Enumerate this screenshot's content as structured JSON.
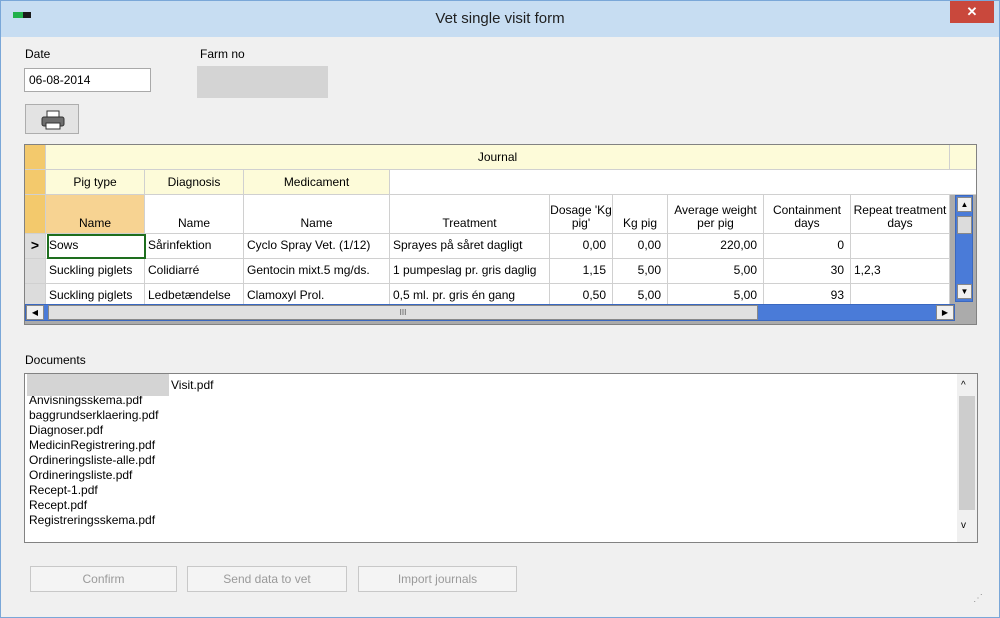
{
  "window": {
    "title": "Vet single visit form",
    "close_glyph": "✕"
  },
  "form": {
    "date_label": "Date",
    "date_value": "06-08-2014",
    "farm_no_label": "Farm no",
    "print_icon": "printer-icon"
  },
  "grid": {
    "group_header": "Journal",
    "section_headers": [
      "Pig type",
      "Diagnosis",
      "Medicament"
    ],
    "columns": [
      "Name",
      "Name",
      "Name",
      "Treatment",
      "Dosage 'Kg pig'",
      "Kg pig",
      "Average weight per pig",
      "Containment days",
      "Repeat treatment days"
    ],
    "current_row_marker": ">",
    "rows": [
      [
        "Sows",
        "Sårinfektion",
        "Cyclo Spray Vet. (1/12)",
        "Sprayes på såret dagligt",
        "0,00",
        "0,00",
        "220,00",
        "0",
        ""
      ],
      [
        "Suckling piglets",
        "Colidiarré",
        "Gentocin mixt.5 mg/ds.",
        "1 pumpeslag pr. gris daglig",
        "1,15",
        "5,00",
        "5,00",
        "30",
        "1,2,3"
      ],
      [
        "Suckling piglets",
        "Ledbetændelse",
        "Clamoxyl Prol.",
        "0,5 ml. pr. gris én gang",
        "0,50",
        "5,00",
        "5,00",
        "93",
        ""
      ]
    ],
    "scroll_grip": "III"
  },
  "documents": {
    "label": "Documents",
    "items": [
      "Visit.pdf",
      "Anvisningsskema.pdf",
      "baggrundserklaering.pdf",
      "Diagnoser.pdf",
      "MedicinRegistrering.pdf",
      "Ordineringsliste-alle.pdf",
      "Ordineringsliste.pdf",
      "Recept-1.pdf",
      "Recept.pdf",
      "Registreringsskema.pdf"
    ]
  },
  "buttons": {
    "confirm": "Confirm",
    "send": "Send data to vet",
    "import": "Import journals"
  }
}
